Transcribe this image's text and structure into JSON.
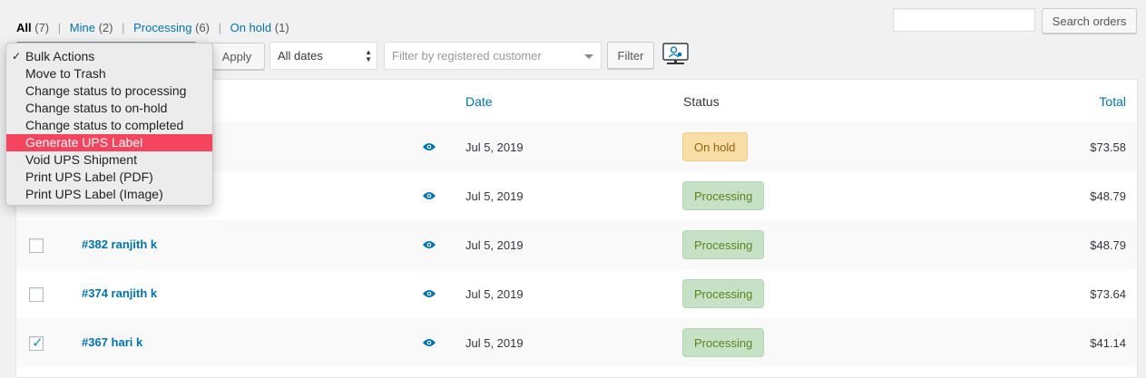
{
  "filters": {
    "all_label": "All",
    "all_count": "(7)",
    "mine_label": "Mine",
    "mine_count": "(2)",
    "processing_label": "Processing",
    "processing_count": "(6)",
    "onhold_label": "On hold",
    "onhold_count": "(1)",
    "separator": "|"
  },
  "search": {
    "value": "",
    "button_label": "Search orders"
  },
  "tablenav": {
    "apply_label": "Apply",
    "dates_value": "All dates",
    "customer_placeholder": "Filter by registered customer",
    "filter_label": "Filter",
    "export_icon": "monitor-user-icon"
  },
  "bulk_menu": {
    "items": [
      {
        "label": "Bulk Actions",
        "checked": true
      },
      {
        "label": "Move to Trash"
      },
      {
        "label": "Change status to processing"
      },
      {
        "label": "Change status to on-hold"
      },
      {
        "label": "Change status to completed"
      },
      {
        "label": "Generate UPS Label",
        "highlighted": true
      },
      {
        "label": "Void UPS Shipment"
      },
      {
        "label": "Print UPS Label (PDF)"
      },
      {
        "label": "Print UPS Label (Image)"
      }
    ],
    "check_glyph": "✓"
  },
  "table": {
    "headers": {
      "date": "Date",
      "status": "Status",
      "total": "Total"
    },
    "rows": [
      {
        "order": "",
        "date": "Jul 5, 2019",
        "status": "On hold",
        "total": "$73.58",
        "checked": false
      },
      {
        "order": "",
        "date": "Jul 5, 2019",
        "status": "Processing",
        "total": "$48.79",
        "checked": false
      },
      {
        "order": "#382 ranjith k",
        "date": "Jul 5, 2019",
        "status": "Processing",
        "total": "$48.79",
        "checked": false
      },
      {
        "order": "#374 ranjith k",
        "date": "Jul 5, 2019",
        "status": "Processing",
        "total": "$73.64",
        "checked": false
      },
      {
        "order": "#367 hari k",
        "date": "Jul 5, 2019",
        "status": "Processing",
        "total": "$41.14",
        "checked": true
      }
    ],
    "check_glyph": "✓"
  },
  "colors": {
    "link": "#0073aa",
    "highlight": "#f5445d",
    "onhold_bg": "#f8dda7",
    "processing_bg": "#c6e1c6"
  }
}
